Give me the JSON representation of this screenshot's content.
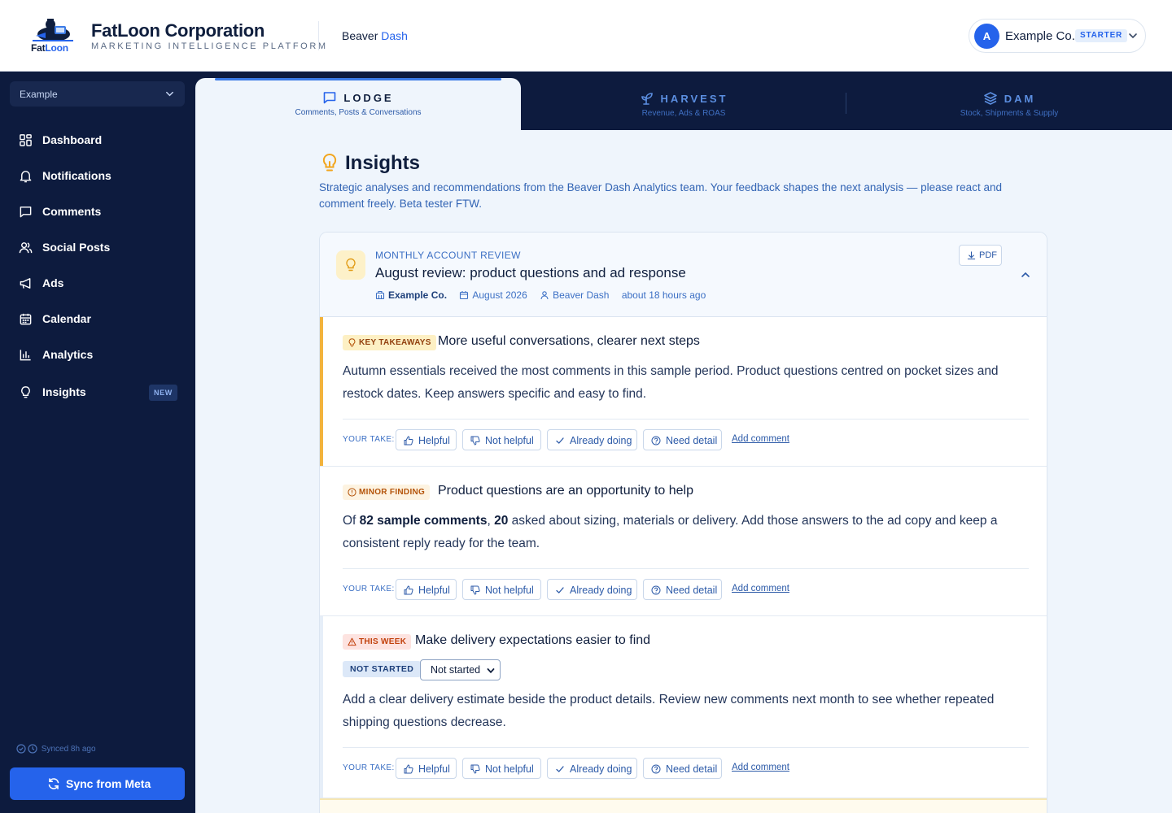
{
  "header": {
    "brand_word_1": "Fat",
    "brand_word_2": "Loon",
    "title": "FatLoon Corporation",
    "subtitle": "MARKETING INTELLIGENCE PLATFORM",
    "crumb_1": "Beaver",
    "crumb_2": "Dash",
    "account": {
      "initial": "A",
      "name": "Example Co.",
      "plan": "STARTER"
    }
  },
  "sidebar": {
    "workspace": "Example",
    "items": [
      {
        "label": "Dashboard",
        "icon": "dashboard-icon"
      },
      {
        "label": "Notifications",
        "icon": "bell-icon"
      },
      {
        "label": "Comments",
        "icon": "comment-icon"
      },
      {
        "label": "Social Posts",
        "icon": "users-icon"
      },
      {
        "label": "Ads",
        "icon": "megaphone-icon"
      },
      {
        "label": "Calendar",
        "icon": "calendar-icon"
      },
      {
        "label": "Analytics",
        "icon": "bar-chart-icon"
      },
      {
        "label": "Insights",
        "icon": "lightbulb-icon",
        "badge": "NEW"
      }
    ],
    "synced": "Synced 8h ago",
    "sync_button": "Sync from Meta"
  },
  "tabs": [
    {
      "label": "LODGE",
      "sub": "Comments, Posts & Conversations",
      "icon": "comment-icon",
      "active": true
    },
    {
      "label": "HARVEST",
      "sub": "Revenue, Ads & ROAS",
      "icon": "sprout-icon",
      "active": false
    },
    {
      "label": "DAM",
      "sub": "Stock, Shipments & Supply",
      "icon": "layers-icon",
      "active": false
    }
  ],
  "page": {
    "title": "Insights",
    "description": "Strategic analyses and recommendations from the Beaver Dash Analytics team. Your feedback shapes the next analysis — please react and comment freely. Beta tester FTW."
  },
  "report": {
    "eyebrow": "MONTHLY ACCOUNT REVIEW",
    "title": "August review: product questions and ad response",
    "company": "Example Co.",
    "period": "August 2026",
    "author": "Beaver Dash",
    "time": "about 18 hours ago",
    "pdf_label": "PDF"
  },
  "feedback": {
    "take_label": "YOUR TAKE:",
    "helpful": "Helpful",
    "not_helpful": "Not helpful",
    "already_doing": "Already doing",
    "need_detail": "Need detail",
    "add_comment": "Add comment"
  },
  "sections": [
    {
      "tag": "KEY TAKEAWAYS",
      "title": "More useful conversations, clearer next steps",
      "body": "Autumn essentials received the most comments in this sample period. Product questions centred on pocket sizes and restock dates. Keep answers specific and easy to find."
    },
    {
      "tag": "MINOR FINDING",
      "title": "Product questions are an opportunity to help",
      "body_pre": "Of ",
      "body_bold_1": "82 sample comments",
      "body_mid": ", ",
      "body_bold_2": "20",
      "body_post": " asked about sizing, materials or delivery. Add those answers to the ad copy and keep a consistent reply ready for the team."
    },
    {
      "tag": "THIS WEEK",
      "title": "Make delivery expectations easier to find",
      "status": "NOT STARTED",
      "status_select": "Not started",
      "body": "Add a clear delivery estimate beside the product details. Review new comments next month to see whether repeated shipping questions decrease."
    }
  ],
  "colors": {
    "navy": "#0d1b3e",
    "accent": "#2563eb",
    "takeaway_accent": "#f2b33d",
    "finding_text": "#b45309",
    "this_week_text": "#c2410c"
  }
}
